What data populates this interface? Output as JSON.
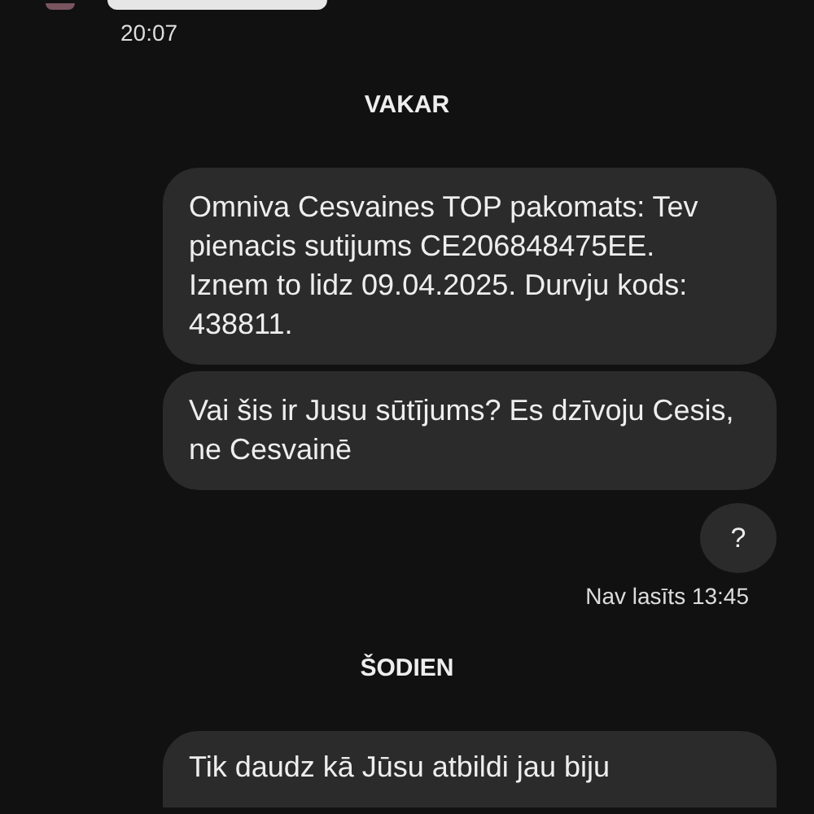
{
  "messages": [
    {
      "kind": "incoming_cut"
    },
    {
      "kind": "time_left",
      "text": "20:07"
    },
    {
      "kind": "day",
      "text": "VAKAR"
    },
    {
      "kind": "outgoing",
      "text": "Omniva Cesvaines TOP pakomats: Tev pienacis sutijums CE206848475EE. Iznem to lidz 09.04.2025. Durvju kods: 438811."
    },
    {
      "kind": "outgoing",
      "text": "Vai šis ir Jusu sūtījums? Es dzīvoju Cesis, ne Cesvainē"
    },
    {
      "kind": "outgoing_round",
      "text": "?"
    },
    {
      "kind": "time_right",
      "text": "Nav lasīts 13:45"
    },
    {
      "kind": "day",
      "text": "ŠODIEN"
    },
    {
      "kind": "outgoing_cut",
      "text": "Tik daudz kā Jūsu atbildi jau biju"
    }
  ]
}
